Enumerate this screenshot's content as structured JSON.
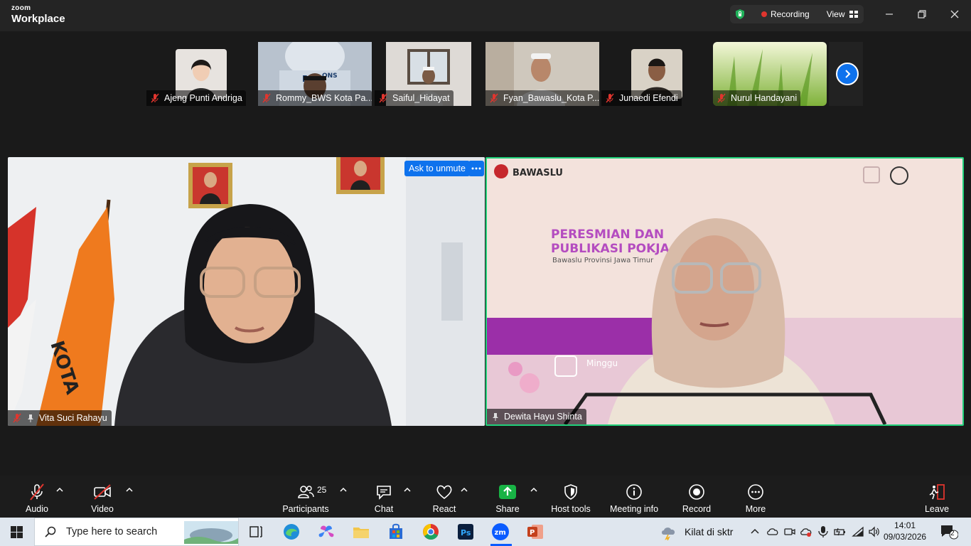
{
  "app": {
    "logo_line1": "zoom",
    "logo_line2": "Workplace"
  },
  "header": {
    "recording_label": "Recording",
    "view_label": "View"
  },
  "colors": {
    "accent": "#0e72ed",
    "active_speaker_border": "#21d07a",
    "recording_dot": "#e0352e",
    "share_green": "#18b345",
    "leave_red": "#e0352e"
  },
  "thumbnails": [
    {
      "name": "Ajeng Punti Andriga"
    },
    {
      "name": "Rommy_BWS Kota Pa..."
    },
    {
      "name": "Saiful_Hidayat"
    },
    {
      "name": "Fyan_Bawaslu_Kota P..."
    },
    {
      "name": "Junaedi Efendi"
    },
    {
      "name": "Nurul Handayani"
    }
  ],
  "main_videos": {
    "left": {
      "name": "Vita Suci Rahayu",
      "ask_to_unmute": "Ask to unmute"
    },
    "right": {
      "name": "Dewita Hayu Shinta",
      "bg_brand": "BAWASLU",
      "bg_title_line1": "PERESMIAN DAN",
      "bg_title_line2": "PUBLIKASI POKJA PPKS",
      "bg_subtitle": "Bawaslu Provinsi Jawa Timur",
      "bg_day": "Minggu"
    }
  },
  "toolbar": {
    "audio": "Audio",
    "video": "Video",
    "participants": "Participants",
    "participants_count": "25",
    "chat": "Chat",
    "react": "React",
    "share": "Share",
    "host_tools": "Host tools",
    "meeting_info": "Meeting info",
    "record": "Record",
    "more": "More",
    "leave": "Leave"
  },
  "taskbar": {
    "search_placeholder": "Type here to search",
    "weather": "Kilat di sktr",
    "time": "14:01",
    "date": "09/03/2026",
    "notifications": "2"
  }
}
